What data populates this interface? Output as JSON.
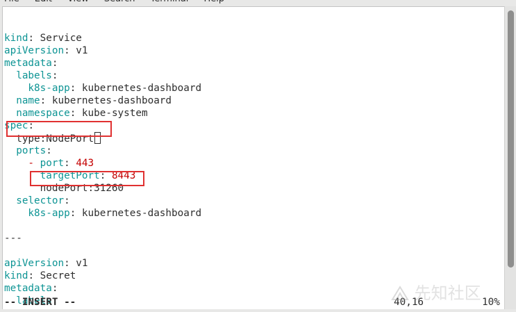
{
  "menu": {
    "items": [
      "File",
      "Edit",
      "View",
      "Search",
      "Terminal",
      "Help"
    ]
  },
  "editor": {
    "lines": [
      [],
      [
        {
          "t": "kind",
          "c": "key"
        },
        {
          "t": ": Service",
          "c": "val"
        }
      ],
      [
        {
          "t": "apiVersion",
          "c": "key"
        },
        {
          "t": ": v1",
          "c": "val"
        }
      ],
      [
        {
          "t": "metadata",
          "c": "key"
        },
        {
          "t": ":",
          "c": "val"
        }
      ],
      [
        {
          "t": "  labels",
          "c": "key"
        },
        {
          "t": ":",
          "c": "val"
        }
      ],
      [
        {
          "t": "    k8s-app",
          "c": "key"
        },
        {
          "t": ": kubernetes-dashboard",
          "c": "val"
        }
      ],
      [
        {
          "t": "  name",
          "c": "key"
        },
        {
          "t": ": kubernetes-dashboard",
          "c": "val"
        }
      ],
      [
        {
          "t": "  namespace",
          "c": "key"
        },
        {
          "t": ": kube-system",
          "c": "val"
        }
      ],
      [
        {
          "t": "spec",
          "c": "key"
        },
        {
          "t": ":",
          "c": "val"
        }
      ],
      [
        {
          "t": "  type:NodePort",
          "c": "val"
        },
        {
          "cursor": true
        }
      ],
      [
        {
          "t": "  ports",
          "c": "key"
        },
        {
          "t": ":",
          "c": "val"
        }
      ],
      [
        {
          "t": "    - ",
          "c": "dash"
        },
        {
          "t": "port",
          "c": "key"
        },
        {
          "t": ": ",
          "c": "val"
        },
        {
          "t": "443",
          "c": "num"
        }
      ],
      [
        {
          "t": "      targetPort",
          "c": "key"
        },
        {
          "t": ": ",
          "c": "val"
        },
        {
          "t": "8443",
          "c": "num"
        }
      ],
      [
        {
          "t": "      nodePort:31260",
          "c": "val"
        }
      ],
      [
        {
          "t": "  selector",
          "c": "key"
        },
        {
          "t": ":",
          "c": "val"
        }
      ],
      [
        {
          "t": "    k8s-app",
          "c": "key"
        },
        {
          "t": ": kubernetes-dashboard",
          "c": "val"
        }
      ],
      [],
      [
        {
          "t": "---",
          "c": "sep"
        }
      ],
      [],
      [
        {
          "t": "apiVersion",
          "c": "key"
        },
        {
          "t": ": v1",
          "c": "val"
        }
      ],
      [
        {
          "t": "kind",
          "c": "key"
        },
        {
          "t": ": Secret",
          "c": "val"
        }
      ],
      [
        {
          "t": "metadata",
          "c": "key"
        },
        {
          "t": ":",
          "c": "val"
        }
      ],
      [
        {
          "t": "  labels",
          "c": "key"
        },
        {
          "t": ":",
          "c": "val"
        }
      ]
    ]
  },
  "status": {
    "mode": "-- INSERT --",
    "position": "40,16",
    "percent": "10%"
  },
  "annotations": {
    "highlight_color": "#e03131"
  },
  "watermark": {
    "text": "先知社区"
  },
  "colors": {
    "key": "#0d9494",
    "number": "#c40000",
    "text": "#2e2e2e",
    "background": "#ffffff"
  }
}
